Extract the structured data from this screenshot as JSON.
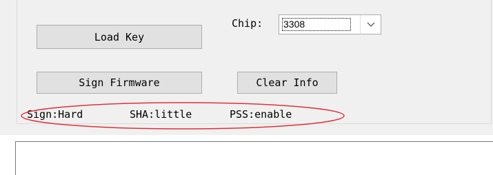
{
  "buttons": {
    "load_key": "Load Key",
    "sign_firmware": "Sign Firmware",
    "clear_info": "Clear Info"
  },
  "chip": {
    "label": "Chip:",
    "selected": "3308",
    "arrow_icon": "chevron-down-icon"
  },
  "status": {
    "sign": "Sign:Hard",
    "sha": "SHA:little",
    "pss": "PSS:enable"
  },
  "annotation": {
    "color": "#e0303a"
  },
  "info": {
    "text": ""
  }
}
